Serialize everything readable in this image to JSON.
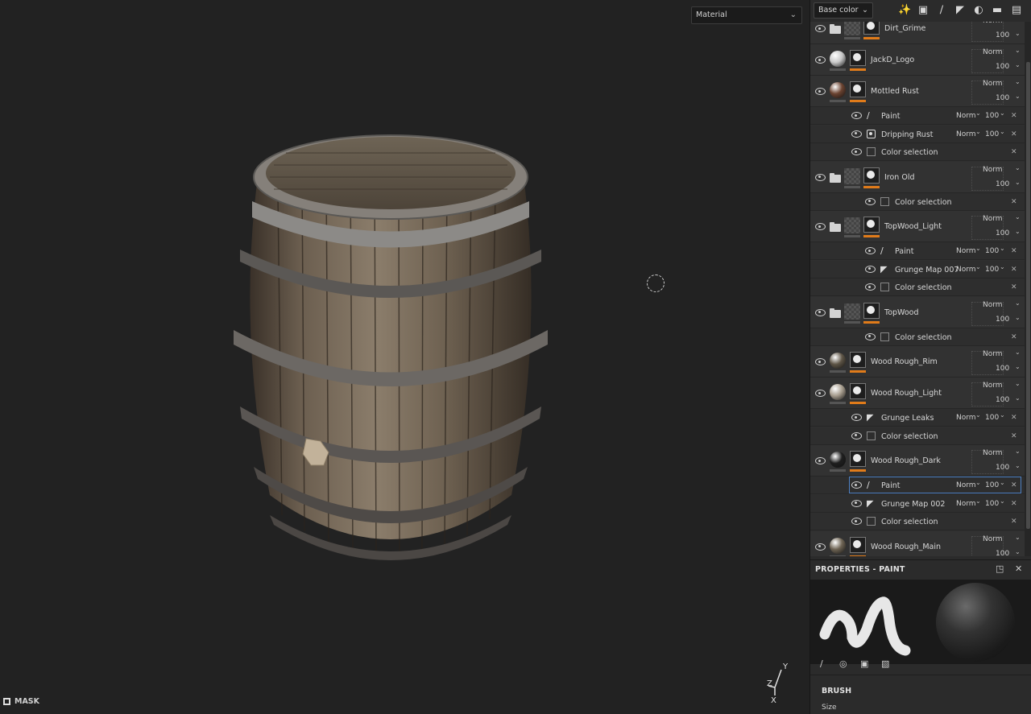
{
  "viewport": {
    "material_select": "Material",
    "mask_label": "MASK",
    "axis": {
      "y": "Y",
      "z": "Z",
      "x": "X"
    }
  },
  "toolbar": {
    "channel_select": "Base color",
    "icons": [
      "magic-wand-icon",
      "add-mask-icon",
      "paint-brush-icon",
      "fill-bucket-icon",
      "generator-icon",
      "folder-icon",
      "trash-icon"
    ]
  },
  "layers": [
    {
      "name": "Dirt_Grime",
      "type": "folder",
      "blend": "Norm",
      "opacity": "100"
    },
    {
      "name": "JackD_Logo",
      "type": "fill",
      "ball_color": "#c8c8c8",
      "blend": "Norm",
      "opacity": "100"
    },
    {
      "name": "Mottled Rust",
      "type": "fill",
      "ball_color": "#6a4230",
      "blend": "Norm",
      "opacity": "100",
      "effects": [
        {
          "name": "Paint",
          "icon": "brush-icon",
          "blend": "Norm",
          "opacity": "100"
        },
        {
          "name": "Dripping Rust",
          "icon": "mask-icon",
          "blend": "Norm",
          "opacity": "100"
        },
        {
          "name": "Color selection",
          "icon": "selection-icon"
        }
      ]
    },
    {
      "name": "Iron Old",
      "type": "folder",
      "blend": "Norm",
      "opacity": "100",
      "effects": [
        {
          "name": "Color selection",
          "icon": "selection-icon"
        }
      ]
    },
    {
      "name": "TopWood_Light",
      "type": "folder",
      "blend": "Norm",
      "opacity": "100",
      "effects": [
        {
          "name": "Paint",
          "icon": "brush-icon",
          "blend": "Norm",
          "opacity": "100"
        },
        {
          "name": "Grunge Map 007",
          "icon": "fill-icon",
          "blend": "Norm",
          "opacity": "100"
        },
        {
          "name": "Color selection",
          "icon": "selection-icon"
        }
      ]
    },
    {
      "name": "TopWood",
      "type": "folder",
      "blend": "Norm",
      "opacity": "100",
      "effects": [
        {
          "name": "Color selection",
          "icon": "selection-icon"
        }
      ]
    },
    {
      "name": "Wood Rough_Rim",
      "type": "fill",
      "ball_color": "#5e5546",
      "blend": "Norm",
      "opacity": "100"
    },
    {
      "name": "Wood Rough_Light",
      "type": "fill",
      "ball_color": "#a79d8e",
      "blend": "Norm",
      "opacity": "100",
      "effects": [
        {
          "name": "Grunge Leaks",
          "icon": "fill-icon",
          "blend": "Norm",
          "opacity": "100"
        },
        {
          "name": "Color selection",
          "icon": "selection-icon"
        }
      ]
    },
    {
      "name": "Wood Rough_Dark",
      "type": "fill",
      "ball_color": "#1e1e1e",
      "blend": "Norm",
      "opacity": "100",
      "effects": [
        {
          "name": "Paint",
          "icon": "brush-icon",
          "blend": "Norm",
          "opacity": "100",
          "selected": true
        },
        {
          "name": "Grunge Map 002",
          "icon": "fill-icon",
          "blend": "Norm",
          "opacity": "100"
        },
        {
          "name": "Color selection",
          "icon": "selection-icon"
        }
      ]
    },
    {
      "name": "Wood Rough_Main",
      "type": "fill",
      "ball_color": "#6d6353",
      "blend": "Norm",
      "opacity": "100"
    }
  ],
  "properties": {
    "title": "PROPERTIES - PAINT",
    "brush_title": "BRUSH",
    "size_label": "Size"
  },
  "colors": {
    "accent_orange": "#e07b1a",
    "selection_blue": "#4d7fc2"
  }
}
